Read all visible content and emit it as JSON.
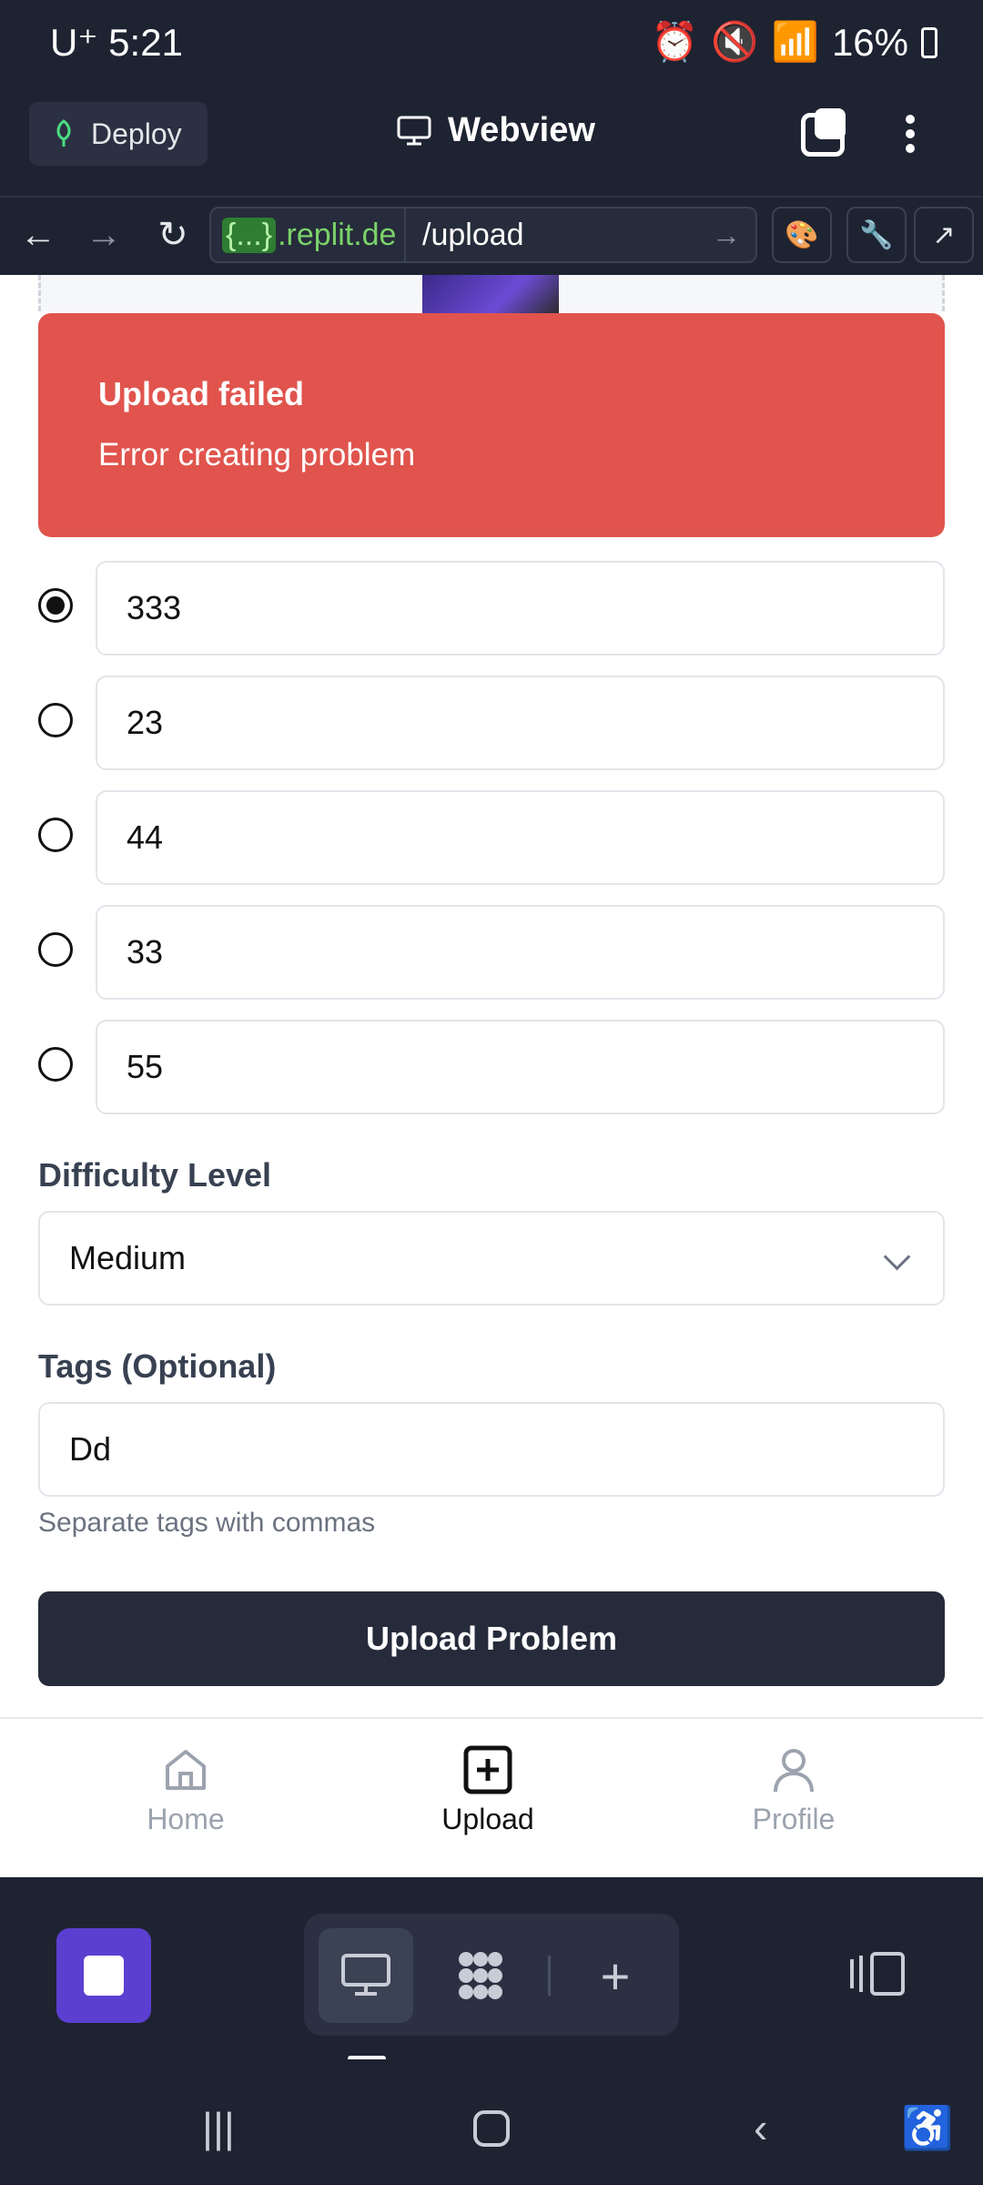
{
  "status_bar": {
    "carrier": "U⁺",
    "time": "5:21",
    "battery": "16%"
  },
  "header": {
    "deploy_label": "Deploy",
    "title": "Webview"
  },
  "url_bar": {
    "host_badge": "{...}",
    "host": ".replit.de",
    "path": "/upload"
  },
  "toast": {
    "title": "Upload failed",
    "description": "Error creating problem"
  },
  "options": [
    {
      "value": "333",
      "selected": true
    },
    {
      "value": "23",
      "selected": false
    },
    {
      "value": "44",
      "selected": false
    },
    {
      "value": "33",
      "selected": false
    },
    {
      "value": "55",
      "selected": false
    }
  ],
  "difficulty": {
    "label": "Difficulty Level",
    "value": "Medium"
  },
  "tags": {
    "label": "Tags (Optional)",
    "value": "Dd",
    "hint": "Separate tags with commas"
  },
  "submit_label": "Upload Problem",
  "bottom_nav": [
    {
      "label": "Home",
      "icon": "home-icon",
      "active": false
    },
    {
      "label": "Upload",
      "icon": "plus-square-icon",
      "active": true
    },
    {
      "label": "Profile",
      "icon": "user-icon",
      "active": false
    }
  ]
}
